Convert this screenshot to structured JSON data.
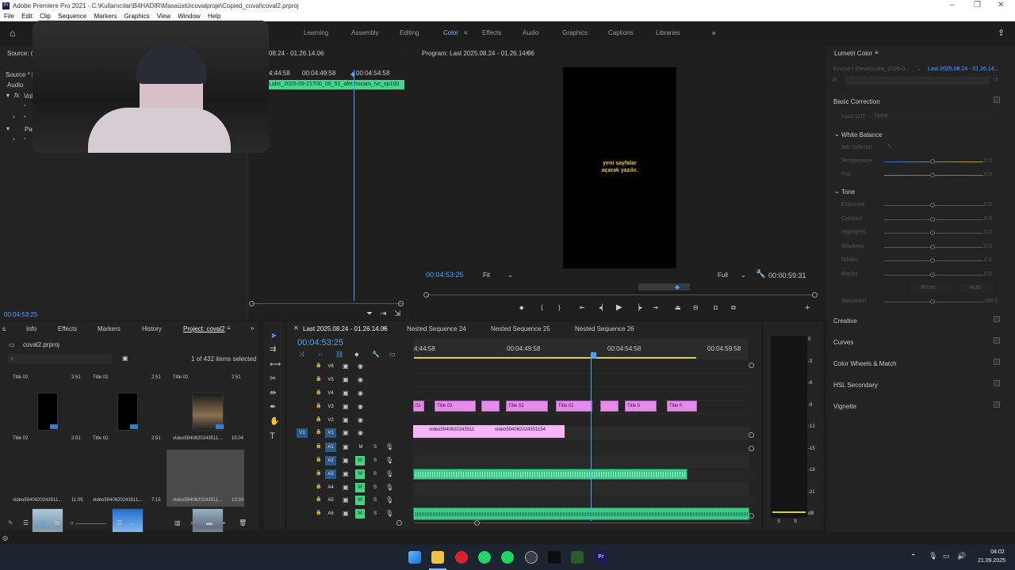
{
  "window": {
    "title": "Adobe Premiere Pro 2021 - C:\\Kullanıcılar\\B4HADIR\\Masaüstü\\covalproje\\Copied_coval\\coval2.prproj",
    "app_badge": "Pr"
  },
  "menu": [
    "File",
    "Edit",
    "Clip",
    "Sequence",
    "Markers",
    "Graphics",
    "View",
    "Window",
    "Help"
  ],
  "workspaces": [
    "Learning",
    "Assembly",
    "Editing",
    "Color",
    "Effects",
    "Audio",
    "Graphics",
    "Captions",
    "Libraries"
  ],
  "active_workspace": "Color",
  "source_panel": {
    "tab_source": "Source: (n",
    "row_source": "Source * E",
    "row_audio": "Audio",
    "row_vol": "Vol",
    "row_par": "Par",
    "time_a": "08.24 - 01.26.14.06",
    "ruler_a": "4:44:58",
    "ruler_b": "00:04:49:58",
    "ruler_c": "00:04:54:58",
    "clip_label": "Labs_2025-09-21T00_00_52_afet hocam_ivc_sp100",
    "timecode": "00:04:53:25"
  },
  "program": {
    "title": "Program: Last 2025.08.24 - 01.26.14.06",
    "caption": "yeni sayfalar\naçarak yazılır.",
    "timecode": "00:04:53:25",
    "fit": "Fit",
    "quality": "Full",
    "duration": "00:00:59:31"
  },
  "lumetri": {
    "title": "Lumetri Color",
    "source": "Source * ElevenLabs_2025-0...",
    "target": "Last 2025.08.24 - 01.26.14...",
    "fx": "fx",
    "basic": "Basic Correction",
    "input_lut": "Input LUT",
    "lut_value": "None",
    "white_balance": "White Balance",
    "wb_selector": "WB Selector",
    "wb_rows": [
      {
        "label": "Temperature",
        "value": "0.0"
      },
      {
        "label": "Tint",
        "value": "0.0"
      }
    ],
    "tone": "Tone",
    "tone_rows": [
      {
        "label": "Exposure",
        "value": "0.0"
      },
      {
        "label": "Contrast",
        "value": "0.0"
      },
      {
        "label": "Highlights",
        "value": "0.0"
      },
      {
        "label": "Shadows",
        "value": "0.0"
      },
      {
        "label": "Whites",
        "value": "0.0"
      },
      {
        "label": "Blacks",
        "value": "0.0"
      }
    ],
    "reset": "Reset",
    "auto": "Auto",
    "saturation": "Saturation",
    "saturation_value": "100.0",
    "sections": [
      "Creative",
      "Curves",
      "Color Wheels & Match",
      "HSL Secondary",
      "Vignette"
    ]
  },
  "project": {
    "tabs": [
      "s",
      "Info",
      "Effects",
      "Markers",
      "History",
      "Project: coval2"
    ],
    "file": "coval2.prproj",
    "count": "1 of 432 items selected",
    "items": [
      {
        "name": "Title 02",
        "dur": "2:51",
        "kind": "black"
      },
      {
        "name": "Title 02",
        "dur": "2:51",
        "kind": "black"
      },
      {
        "name": "Title 02",
        "dur": "2:51",
        "kind": "tunnel"
      },
      {
        "name": "Title 02",
        "dur": "2:51",
        "kind": "none"
      },
      {
        "name": "Title 02",
        "dur": "2:51",
        "kind": "none"
      },
      {
        "name": "video5940620243511...",
        "dur": "15:04",
        "kind": "none"
      },
      {
        "name": "video5940620243511...",
        "dur": "11:05",
        "kind": "beach"
      },
      {
        "name": "video5940620243511...",
        "dur": "7:15",
        "kind": "sky"
      },
      {
        "name": "video5940620243511...",
        "dur": "13:03",
        "kind": "sea"
      }
    ]
  },
  "timeline": {
    "tabs": [
      "Last 2025.08.24 - 01.26.14.06",
      "Nested Sequence 24",
      "Nested Sequence 25",
      "Nested Sequence 26"
    ],
    "timecode": "00:04:53:25",
    "ruler": [
      "4:44:58",
      "00:04:49:58",
      "00:04:54:58",
      "00:04:59:58"
    ],
    "video_tracks": [
      "V6",
      "V5",
      "V4",
      "V3",
      "V2",
      "V1"
    ],
    "audio_tracks": [
      "A1",
      "A2",
      "A3",
      "A4",
      "A5",
      "A6"
    ],
    "source_patch_v": "V1",
    "m": "M",
    "s": "S",
    "v3_clips": [
      {
        "label": "02"
      },
      {
        "label": "Title 02"
      },
      {
        "label": ""
      },
      {
        "label": "Title 02"
      },
      {
        "label": "Title 02"
      },
      {
        "label": ""
      },
      {
        "label": "Title 0"
      },
      {
        "label": "Title 0"
      }
    ],
    "v1_clips": [
      {
        "label": ""
      },
      {
        "label": "video5940620243511"
      },
      {
        "label": "video594062024351154"
      }
    ]
  },
  "meter_scale": [
    "0",
    "-3",
    "-6",
    "-9",
    "-12",
    "-15",
    "-18",
    "-21",
    "dB"
  ],
  "meter_buttons": [
    "S",
    "S"
  ],
  "clock": {
    "time": "04:02",
    "date": "21.09.2025"
  }
}
